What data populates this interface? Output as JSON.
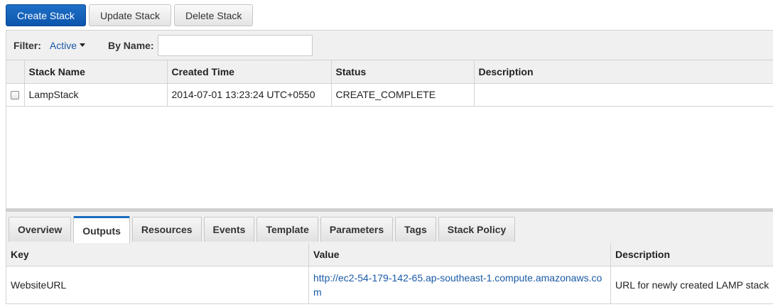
{
  "toolbar": {
    "create_label": "Create Stack",
    "update_label": "Update Stack",
    "delete_label": "Delete Stack"
  },
  "filter": {
    "label": "Filter:",
    "value": "Active",
    "by_name_label": "By Name:",
    "by_name_value": "",
    "by_name_placeholder": ""
  },
  "stacks": {
    "columns": [
      "Stack Name",
      "Created Time",
      "Status",
      "Description"
    ],
    "rows": [
      {
        "name": "LampStack",
        "created": "2014-07-01 13:23:24 UTC+0550",
        "status": "CREATE_COMPLETE",
        "description": ""
      }
    ]
  },
  "colors": {
    "primary": "#0c56ac",
    "status_complete": "#3c8a00",
    "link": "#1a5aa6",
    "active_tab_border": "#1a6cc0"
  },
  "tabs": {
    "items": [
      "Overview",
      "Outputs",
      "Resources",
      "Events",
      "Template",
      "Parameters",
      "Tags",
      "Stack Policy"
    ],
    "active": "Outputs"
  },
  "outputs": {
    "columns": [
      "Key",
      "Value",
      "Description"
    ],
    "rows": [
      {
        "key": "WebsiteURL",
        "value": "http://ec2-54-179-142-65.ap-southeast-1.compute.amazonaws.com",
        "description": "URL for newly created LAMP stack"
      }
    ]
  },
  "icons": {
    "filter_caret": "caret-down-icon",
    "row_checkbox": "checkbox-icon"
  }
}
